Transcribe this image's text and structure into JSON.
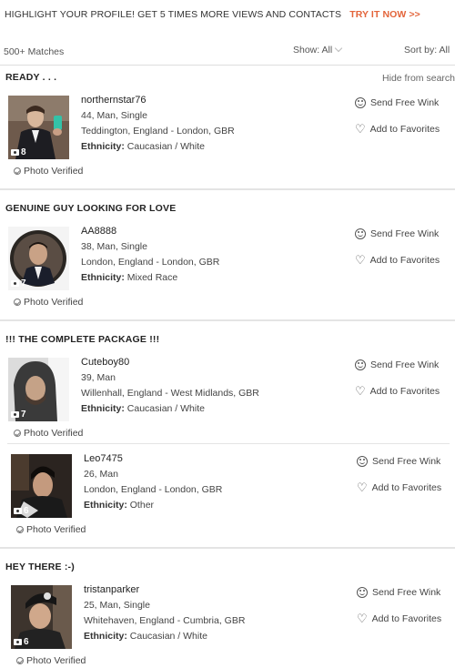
{
  "promo": {
    "text": "HIGHLIGHT YOUR PROFILE! GET 5 TIMES MORE VIEWS AND CONTACTS",
    "cta": "TRY IT NOW >>"
  },
  "toolbar": {
    "matches": "500+ Matches",
    "show_label": "Show:",
    "show_value": "All",
    "sort_label": "Sort by:",
    "sort_value": "All"
  },
  "actions": {
    "wink": "Send Free Wink",
    "favorite": "Add to Favorites",
    "hide": "Hide from search",
    "verified": "Photo Verified",
    "ethnicity_label": "Ethnicity:"
  },
  "sections": [
    {
      "title": "READY . . .",
      "profiles": [
        {
          "username": "northernstar76",
          "details": "44, Man, Single",
          "location": "Teddington, England - London, GBR",
          "ethnicity": "Caucasian / White",
          "photos": "8"
        }
      ]
    },
    {
      "title": "GENUINE GUY LOOKING FOR LOVE",
      "profiles": [
        {
          "username": "AA8888",
          "details": "38, Man, Single",
          "location": "London, England - London, GBR",
          "ethnicity": "Mixed Race",
          "photos": "7"
        }
      ]
    },
    {
      "title": "!!! THE COMPLETE PACKAGE !!!",
      "profiles": [
        {
          "username": "Cuteboy80",
          "details": "39, Man",
          "location": "Willenhall, England - West Midlands, GBR",
          "ethnicity": "Caucasian / White",
          "photos": "7"
        },
        {
          "username": "Leo7475",
          "details": "26, Man",
          "location": "London, England - London, GBR",
          "ethnicity": "Other",
          "photos": "6"
        }
      ]
    },
    {
      "title": "HEY THERE :-)",
      "profiles": [
        {
          "username": "tristanparker",
          "details": "25, Man, Single",
          "location": "Whitehaven, England - Cumbria, GBR",
          "ethnicity": "Caucasian / White",
          "photos": "6"
        }
      ]
    }
  ]
}
